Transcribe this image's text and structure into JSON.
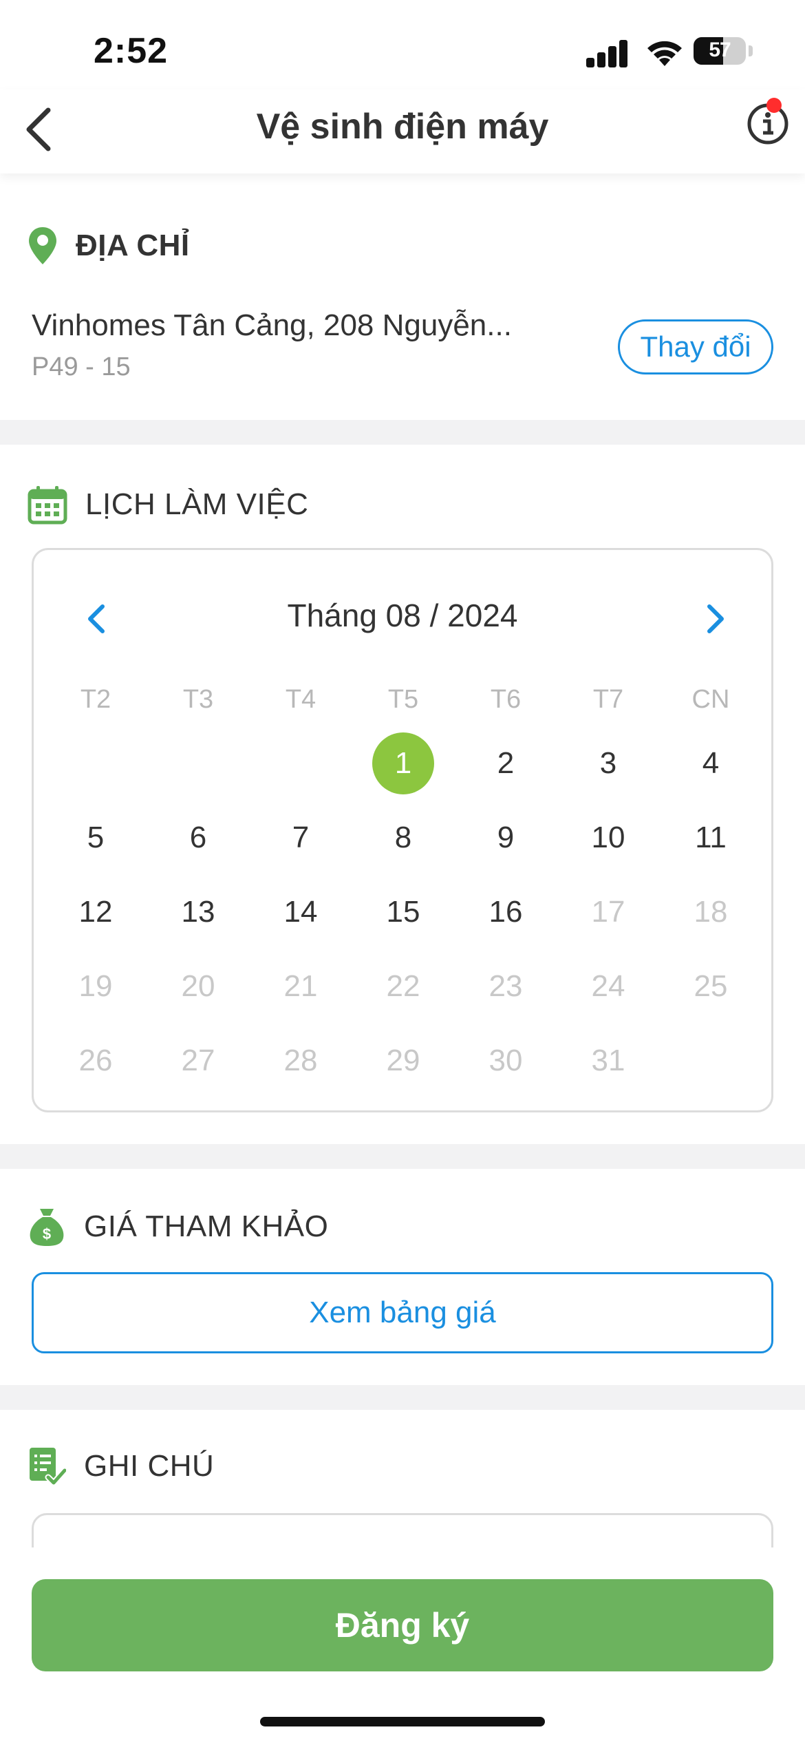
{
  "status_bar": {
    "time": "2:52",
    "battery": "57",
    "battery_level": 0.57
  },
  "nav": {
    "title": "Vệ sinh điện máy",
    "back_icon": "chevron-left-icon",
    "info_icon": "info-icon",
    "has_notification": true
  },
  "address": {
    "heading": "ĐỊA CHỈ",
    "icon": "map-pin-icon",
    "line1": "Vinhomes Tân Cảng,  208 Nguyễn...",
    "line2": "P49 - 15",
    "change_label": "Thay đổi"
  },
  "schedule": {
    "heading": "LỊCH LÀM VIỆC",
    "icon": "calendar-icon",
    "month_title": "Tháng 08 / 2024",
    "weekdays": [
      "T2",
      "T3",
      "T4",
      "T5",
      "T6",
      "T7",
      "CN"
    ],
    "first_weekday_index": 3,
    "days_in_month": 31,
    "selected_day": 1,
    "last_enabled_day": 16
  },
  "price": {
    "heading": "GIÁ THAM KHẢO",
    "icon": "money-bag-icon",
    "button_label": "Xem bảng giá"
  },
  "note": {
    "heading": "GHI CHÚ",
    "icon": "note-check-icon",
    "placeholder": ""
  },
  "footer": {
    "submit_label": "Đăng ký"
  },
  "colors": {
    "green": "#6cb35e",
    "selected": "#8cc63f",
    "blue": "#1a8fe0",
    "icon_green": "#5fae55"
  }
}
